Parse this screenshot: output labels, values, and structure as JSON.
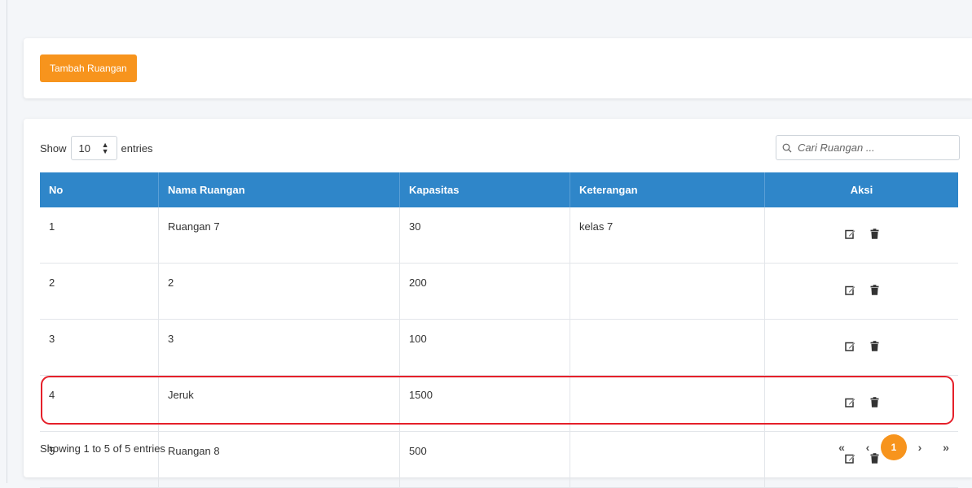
{
  "top_card": {
    "add_button_label": "Tambah Ruangan"
  },
  "length_menu": {
    "show_label": "Show",
    "selected": "10",
    "entries_label": "entries"
  },
  "search": {
    "placeholder": "Cari Ruangan ..."
  },
  "table": {
    "headers": [
      "No",
      "Nama Ruangan",
      "Kapasitas",
      "Keterangan",
      "Aksi"
    ],
    "rows": [
      {
        "no": "1",
        "nama": "Ruangan 7",
        "kapasitas": "30",
        "keterangan": "kelas 7"
      },
      {
        "no": "2",
        "nama": "2",
        "kapasitas": "200",
        "keterangan": ""
      },
      {
        "no": "3",
        "nama": "3",
        "kapasitas": "100",
        "keterangan": ""
      },
      {
        "no": "4",
        "nama": "Jeruk",
        "kapasitas": "1500",
        "keterangan": ""
      },
      {
        "no": "5",
        "nama": "Ruangan 8",
        "kapasitas": "500",
        "keterangan": ""
      }
    ],
    "action_icons": [
      "edit-icon",
      "trash-icon"
    ]
  },
  "info_text": "Showing 1 to 5 of 5 entries",
  "pagination": {
    "first": "«",
    "prev": "‹",
    "current": "1",
    "next": "›",
    "last": "»"
  },
  "colors": {
    "accent": "#f7941d",
    "header": "#2f86c9",
    "highlight": "#e5202a"
  }
}
